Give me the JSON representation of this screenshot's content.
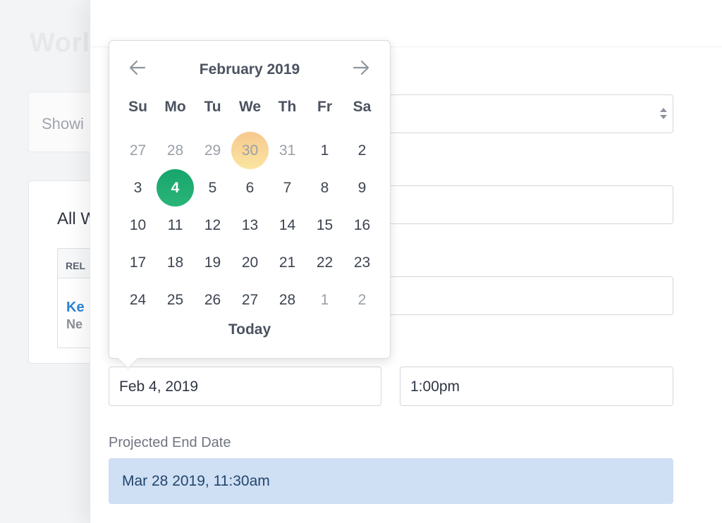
{
  "background": {
    "title": "Worl",
    "showing_label": "Showi",
    "card_title": "All W",
    "table_header": "REL",
    "link_text": "Ke",
    "link_sub": "Ne"
  },
  "form": {
    "start_date_value": "Feb 4, 2019",
    "start_time_value": "1:00pm",
    "projected_end_label": "Projected End Date",
    "projected_end_value": "Mar 28 2019, 11:30am"
  },
  "datepicker": {
    "month_label": "February 2019",
    "prev_icon": "arrow-left-icon",
    "next_icon": "arrow-right-icon",
    "weekdays": [
      "Su",
      "Mo",
      "Tu",
      "We",
      "Th",
      "Fr",
      "Sa"
    ],
    "weeks": [
      [
        "27",
        "28",
        "29",
        "30",
        "31",
        "1",
        "2"
      ],
      [
        "3",
        "4",
        "5",
        "6",
        "7",
        "8",
        "9"
      ],
      [
        "10",
        "11",
        "12",
        "13",
        "14",
        "15",
        "16"
      ],
      [
        "17",
        "18",
        "19",
        "20",
        "21",
        "22",
        "23"
      ],
      [
        "24",
        "25",
        "26",
        "27",
        "28",
        "1",
        "2"
      ]
    ],
    "outside_month": [
      [
        0,
        0
      ],
      [
        0,
        1
      ],
      [
        0,
        2
      ],
      [
        0,
        3
      ],
      [
        0,
        4
      ],
      [
        4,
        5
      ],
      [
        4,
        6
      ]
    ],
    "today_cell": [
      0,
      3
    ],
    "selected_cell": [
      1,
      1
    ],
    "today_button": "Today",
    "colors": {
      "selected": "#1fac70",
      "today_highlight": "#f8d69a"
    }
  }
}
